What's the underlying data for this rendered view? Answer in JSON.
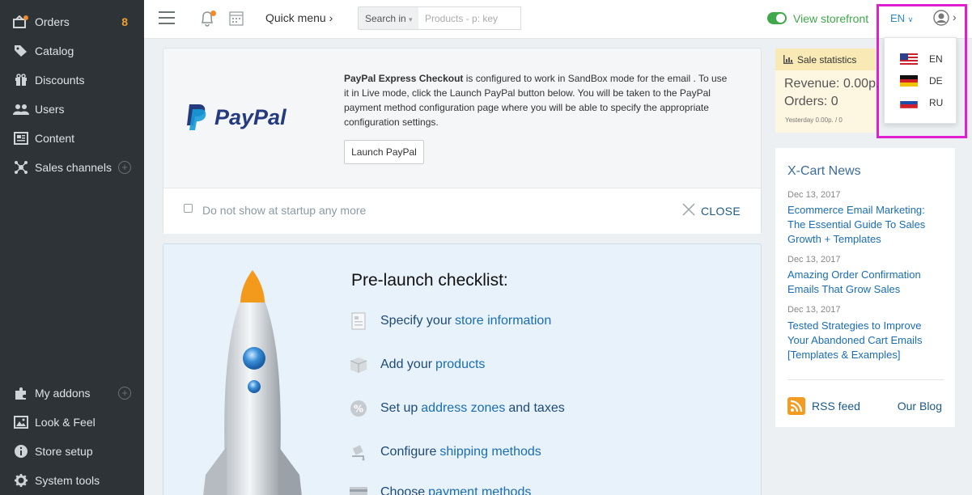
{
  "sidebar": {
    "items": [
      {
        "label": "Orders",
        "icon": "orders-icon",
        "badge": "8"
      },
      {
        "label": "Catalog",
        "icon": "tag-icon"
      },
      {
        "label": "Discounts",
        "icon": "gift-icon"
      },
      {
        "label": "Users",
        "icon": "users-icon"
      },
      {
        "label": "Content",
        "icon": "content-icon"
      },
      {
        "label": "Sales channels",
        "icon": "share-icon"
      }
    ],
    "bottom_items": [
      {
        "label": "My addons",
        "icon": "puzzle-icon"
      },
      {
        "label": "Look & Feel",
        "icon": "image-icon"
      },
      {
        "label": "Store setup",
        "icon": "info-icon"
      },
      {
        "label": "System tools",
        "icon": "gear-icon"
      }
    ]
  },
  "topbar": {
    "quick_menu": "Quick menu",
    "search_in": "Search in",
    "search_placeholder": "Products - p: key",
    "view_storefront": "View storefront",
    "language": "EN"
  },
  "language_dropdown": {
    "options": [
      {
        "code": "EN",
        "flag": "us-flag-icon"
      },
      {
        "code": "DE",
        "flag": "de-flag-icon"
      },
      {
        "code": "RU",
        "flag": "ru-flag-icon"
      }
    ],
    "highlight_color": "#e020d0"
  },
  "paypal": {
    "logo": "PayPal",
    "bold": "PayPal Express Checkout",
    "text": " is configured to work in SandBox mode for the email . To use it in Live mode, click the Launch PayPal button below. You will be taken to the PayPal payment method configuration page where you will be able to specify the appropriate configuration settings.",
    "launch_button": "Launch PayPal",
    "dont_show": "Do not show at startup any more",
    "close": "CLOSE"
  },
  "checklist": {
    "title": "Pre-launch checklist:",
    "items": [
      {
        "pre": "Specify your",
        "link": "store information",
        "post": ""
      },
      {
        "pre": "Add your",
        "link": "products",
        "post": ""
      },
      {
        "pre": "Set up",
        "link": "address zones",
        "post": "and taxes"
      },
      {
        "pre": "Configure",
        "link": "shipping methods",
        "post": ""
      },
      {
        "pre": "Choose",
        "link": "payment methods",
        "post": ""
      }
    ]
  },
  "stats": {
    "title": "Sale statistics",
    "revenue": "Revenue: 0.00p.",
    "orders": "Orders: 0",
    "yesterday": "Yesterday 0.00p. / 0"
  },
  "news": {
    "title": "X-Cart News",
    "items": [
      {
        "date": "Dec 13, 2017",
        "title": "Ecommerce Email Marketing: The Essential Guide To Sales Growth + Templates"
      },
      {
        "date": "Dec 13, 2017",
        "title": "Amazing Order Confirmation Emails That Grow Sales"
      },
      {
        "date": "Dec 13, 2017",
        "title": "Tested Strategies to Improve Your Abandoned Cart Emails [Templates & Examples]"
      }
    ],
    "rss": "RSS feed",
    "blog": "Our Blog"
  }
}
